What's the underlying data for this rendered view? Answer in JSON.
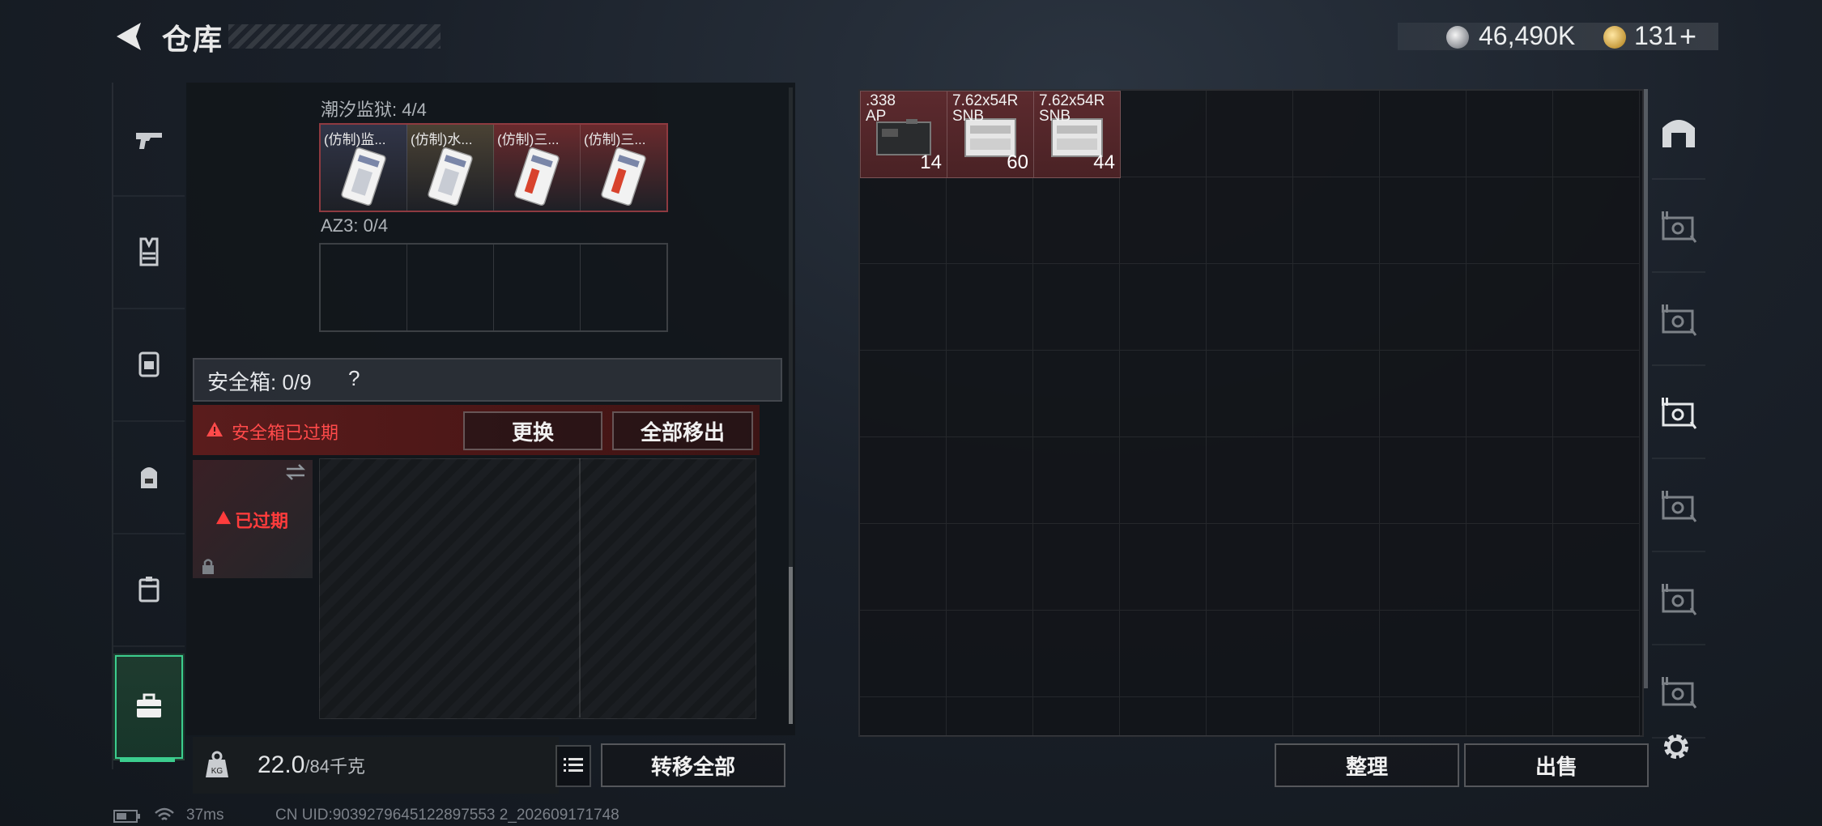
{
  "header": {
    "title": "仓库"
  },
  "currency": {
    "coins": "46,490K",
    "premium": "131",
    "plus": "+"
  },
  "left_nav": {
    "items": [
      "weapons",
      "armor",
      "chest-rig",
      "backpack",
      "pouch",
      "secure-case"
    ]
  },
  "sections": {
    "tide_prison": {
      "label": "潮汐监狱: 4/4",
      "slots": [
        {
          "label": "(仿制)监...",
          "color": "#313548"
        },
        {
          "label": "(仿制)水...",
          "color": "#4a4234"
        },
        {
          "label": "(仿制)三...",
          "color": "#6a2a2d"
        },
        {
          "label": "(仿制)三...",
          "color": "#6a2a2d"
        }
      ]
    },
    "az3": {
      "label": "AZ3: 0/4"
    }
  },
  "secure_case": {
    "label": "安全箱: 0/9",
    "help": "?",
    "warning": "安全箱已过期",
    "replace_label": "更换",
    "move_all_out_label": "全部移出",
    "expired_label": "已过期"
  },
  "bottom_left": {
    "weight_value": "22.0",
    "weight_max": "/84千克",
    "transfer_all_label": "转移全部"
  },
  "stash": {
    "items": [
      {
        "name": ".338\nAP",
        "count": "14"
      },
      {
        "name": "7.62x54R\nSNB",
        "count": "60"
      },
      {
        "name": "7.62x54R\nSNB",
        "count": "44"
      }
    ]
  },
  "right_nav": {
    "items": [
      "stash-home",
      "case-iv-1",
      "case-iv-2",
      "case-iv-3",
      "case-ii",
      "case-iv-4",
      "case-iv-5"
    ]
  },
  "bottom_right": {
    "sort_label": "整理",
    "sell_label": "出售"
  },
  "status_bar": {
    "ping": "37ms",
    "uid": "CN UID:9039279645122897553 2_202609171748"
  }
}
